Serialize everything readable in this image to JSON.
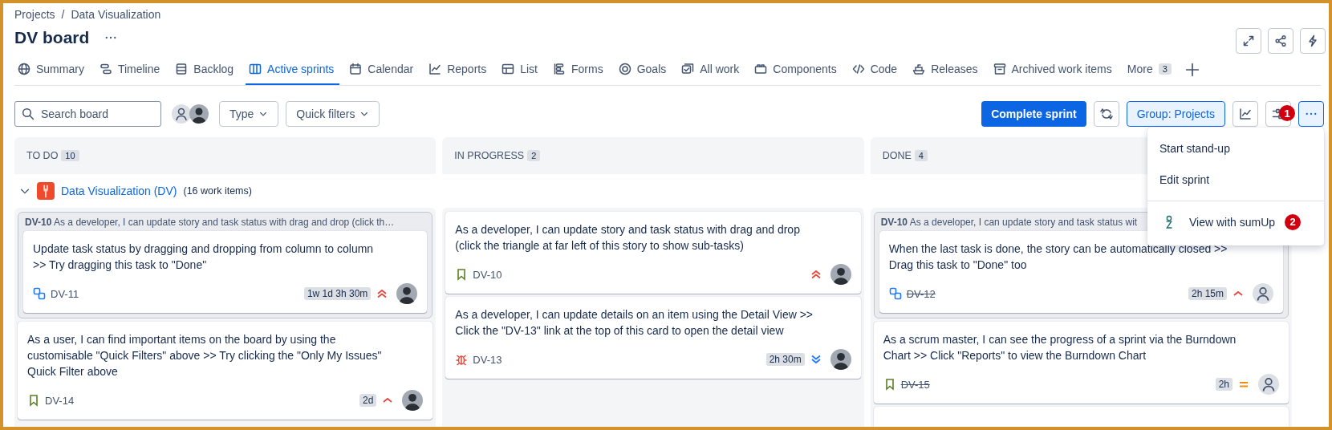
{
  "breadcrumbs": [
    "Projects",
    "Data Visualization"
  ],
  "breadcrumb_separator": "/",
  "title": "DV board",
  "tabs": [
    {
      "label": "Summary",
      "selected": false
    },
    {
      "label": "Timeline",
      "selected": false
    },
    {
      "label": "Backlog",
      "selected": false
    },
    {
      "label": "Active sprints",
      "selected": true
    },
    {
      "label": "Calendar",
      "selected": false
    },
    {
      "label": "Reports",
      "selected": false
    },
    {
      "label": "List",
      "selected": false
    },
    {
      "label": "Forms",
      "selected": false
    },
    {
      "label": "Goals",
      "selected": false
    },
    {
      "label": "All work",
      "selected": false
    },
    {
      "label": "Components",
      "selected": false
    },
    {
      "label": "Code",
      "selected": false
    },
    {
      "label": "Releases",
      "selected": false
    },
    {
      "label": "Archived work items",
      "selected": false
    }
  ],
  "more_tab": {
    "label": "More",
    "count": "3"
  },
  "search": {
    "placeholder": "Search board"
  },
  "people": [
    {
      "kind": "unassigned"
    },
    {
      "kind": "photo"
    }
  ],
  "filters": [
    {
      "label": "Type"
    },
    {
      "label": "Quick filters"
    }
  ],
  "complete_button": "Complete sprint",
  "group_button": {
    "label": "Group: Projects",
    "selected": true
  },
  "settings_badge": "1",
  "more_button": {
    "selected": true
  },
  "menu": {
    "items": [
      {
        "label": "Start stand-up",
        "kind": "plain"
      },
      {
        "label": "Edit sprint",
        "kind": "plain"
      },
      {
        "label": "View with sumUp",
        "kind": "app",
        "badge": "2"
      }
    ]
  },
  "swimlane": {
    "expanded": true,
    "name": "Data Visualization (DV)",
    "count": "(16 work items)"
  },
  "columns": [
    {
      "title": "TO DO",
      "count": "10",
      "items": [
        {
          "kind": "parent",
          "key": "DV-10",
          "summary": "As a developer, I can update story and task status with drag and drop (click th…",
          "children": [
            {
              "summary": "Update task status by dragging and dropping from column to column >> Try dragging this task to \"Done\"",
              "type_icon": {
                "kind": "subtask"
              },
              "key": "DV-11",
              "done": false,
              "estimate": "1w 1d 3h 30m",
              "priority": {
                "kind": "highest"
              },
              "avatar": {
                "kind": "photo"
              }
            }
          ]
        },
        {
          "kind": "card",
          "summary": "As a user, I can find important items on the board by using the customisable \"Quick Filters\" above >> Try clicking the \"Only My Issues\" Quick Filter above",
          "type_icon": {
            "kind": "story"
          },
          "key": "DV-14",
          "done": false,
          "estimate": "2d",
          "priority": {
            "kind": "high"
          },
          "avatar": {
            "kind": "photo"
          }
        }
      ]
    },
    {
      "title": "IN PROGRESS",
      "count": "2",
      "items": [
        {
          "kind": "card",
          "summary": "As a developer, I can update story and task status with drag and drop (click the triangle at far left of this story to show sub-tasks)",
          "type_icon": {
            "kind": "story"
          },
          "key": "DV-10",
          "done": false,
          "priority": {
            "kind": "highest"
          },
          "avatar": {
            "kind": "photo"
          }
        },
        {
          "kind": "card",
          "summary": "As a developer, I can update details on an item using the Detail View >> Click the \"DV-13\" link at the top of this card to open the detail view",
          "type_icon": {
            "kind": "bug"
          },
          "key": "DV-13",
          "done": false,
          "estimate": "2h 30m",
          "priority": {
            "kind": "lowest"
          },
          "avatar": {
            "kind": "photo"
          }
        }
      ]
    },
    {
      "title": "DONE",
      "count": "4",
      "items": [
        {
          "kind": "parent",
          "key": "DV-10",
          "summary": "As a developer, I can update story and task status wit",
          "children": [
            {
              "summary": "When the last task is done, the story can be automatically closed >> Drag this task to \"Done\" too",
              "type_icon": {
                "kind": "subtask"
              },
              "key": "DV-12",
              "done": true,
              "estimate": "2h 15m",
              "priority": {
                "kind": "high"
              },
              "avatar": {
                "kind": "unassigned"
              }
            }
          ]
        },
        {
          "kind": "card",
          "summary": "As a scrum master, I can see the progress of a sprint via the Burndown Chart >> Click \"Reports\" to view the Burndown Chart",
          "type_icon": {
            "kind": "story"
          },
          "key": "DV-15",
          "done": true,
          "estimate": "2h",
          "priority": {
            "kind": "medium"
          },
          "avatar": {
            "kind": "unassigned"
          }
        },
        {
          "kind": "clipped"
        }
      ]
    }
  ]
}
